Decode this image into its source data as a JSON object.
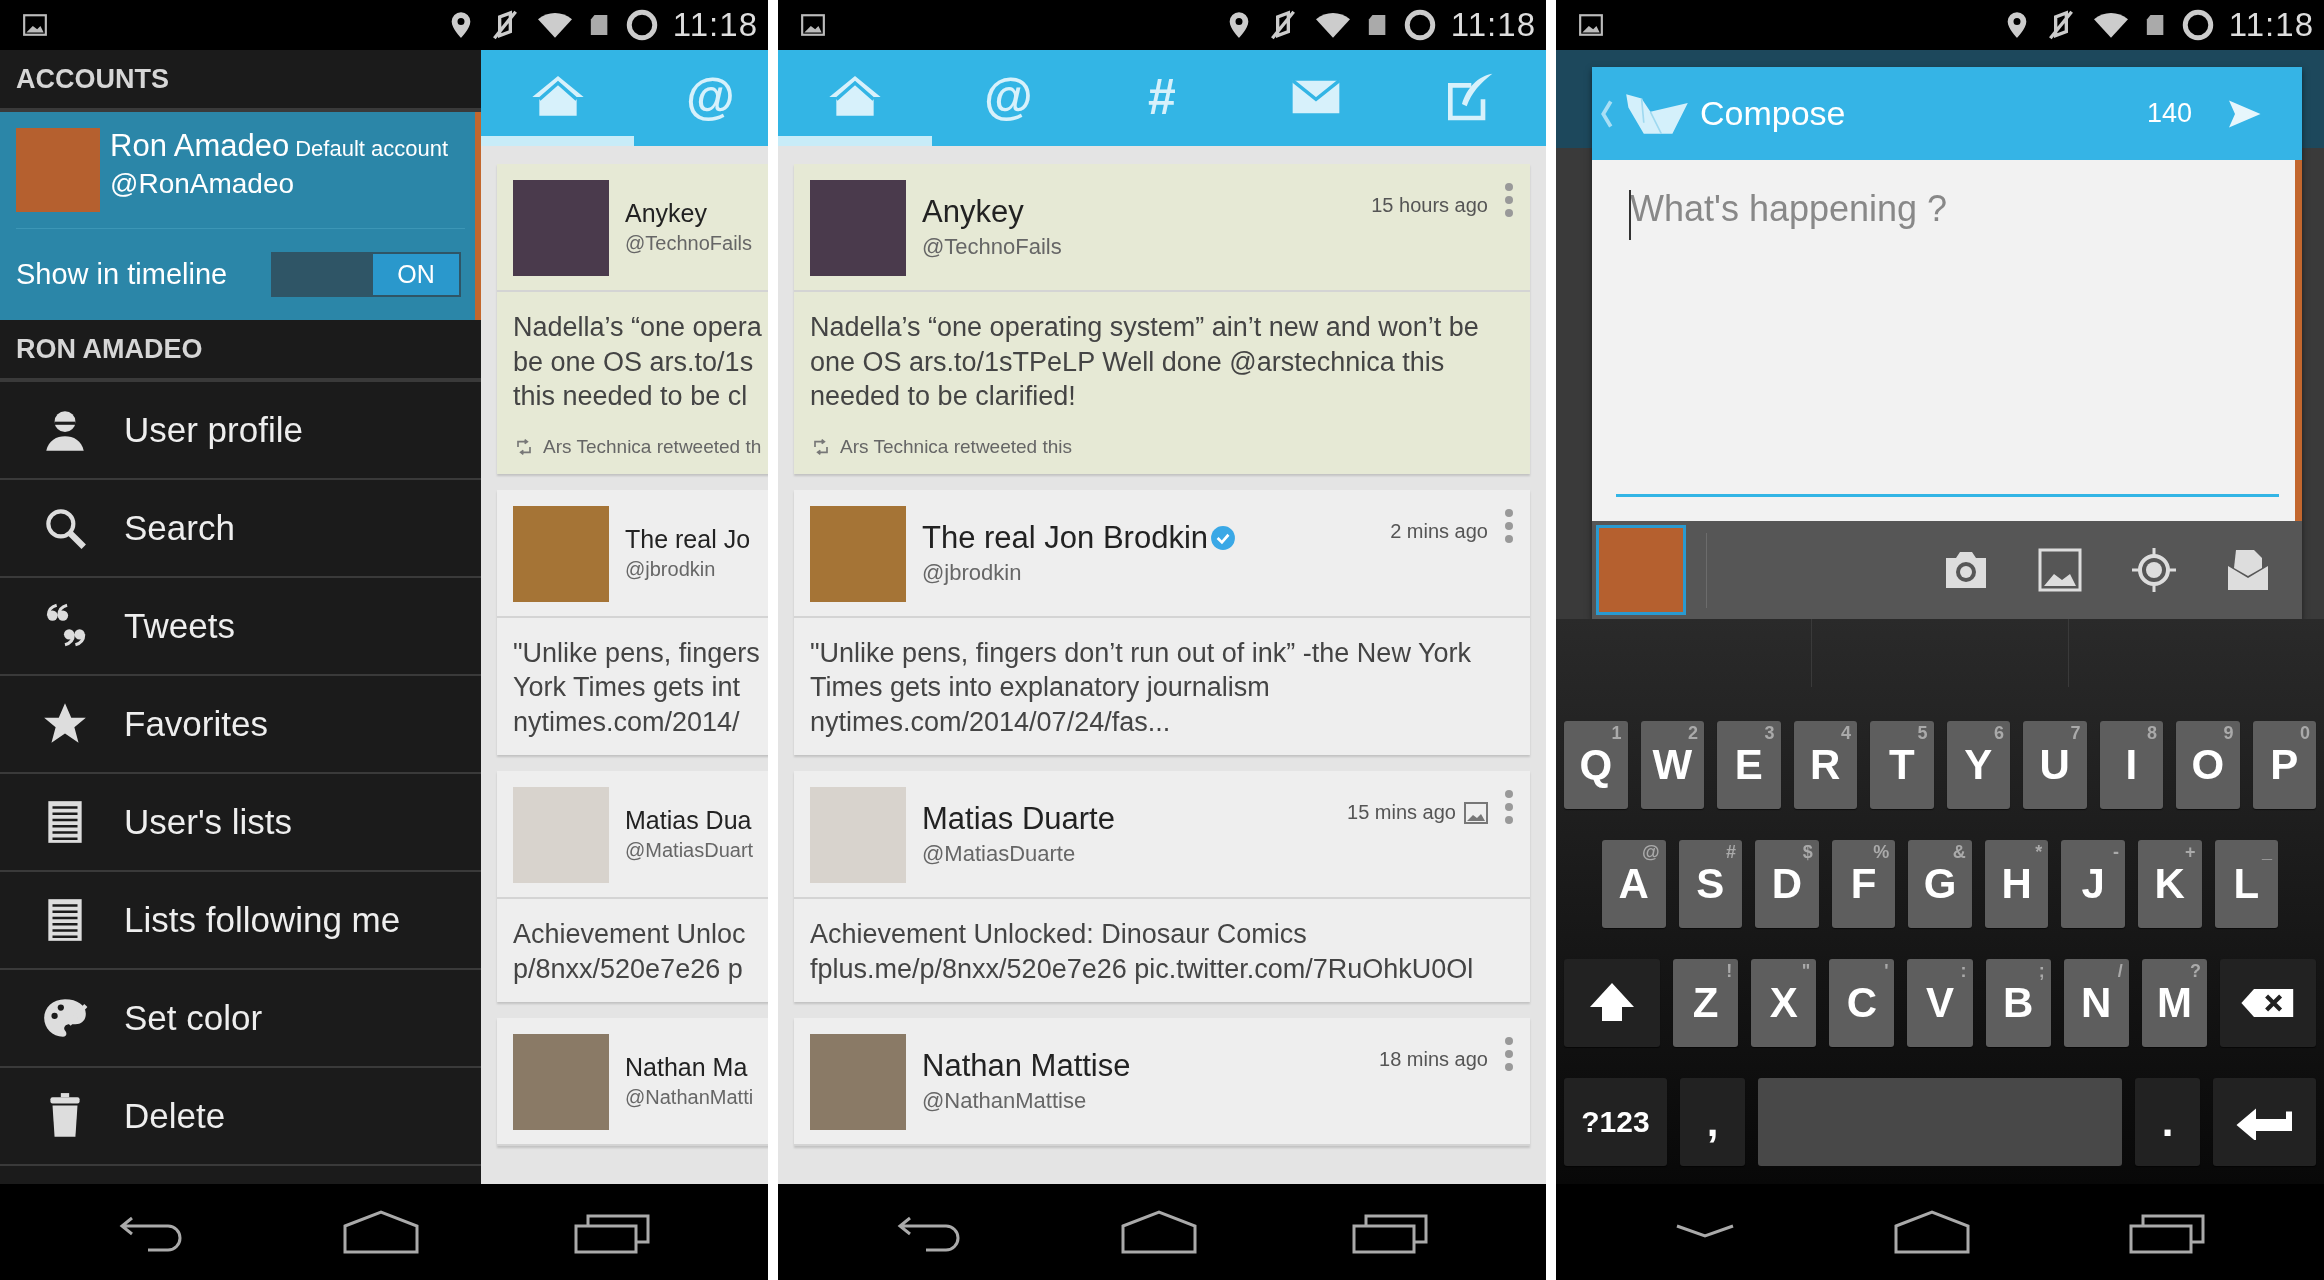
{
  "screens": [
    {
      "kind": "drawer",
      "status_bar": {
        "time": "11:18"
      },
      "nav_bar": {
        "dismiss_keyboard": false
      },
      "drawer": {
        "accounts_header": "ACCOUNTS",
        "account": {
          "name": "Ron Amadeo",
          "badge": "Default account",
          "handle": "@RonAmadeo",
          "toggle_label": "Show in timeline",
          "toggle_on": true,
          "toggle_text": "ON"
        },
        "section_header": "RON AMADEO",
        "items": [
          {
            "kind": "profile",
            "label": "User profile"
          },
          {
            "kind": "search",
            "label": "Search"
          },
          {
            "kind": "tweets",
            "label": "Tweets"
          },
          {
            "kind": "favorites",
            "label": "Favorites"
          },
          {
            "kind": "list",
            "label": "User's lists"
          },
          {
            "kind": "list",
            "label": "Lists following me"
          },
          {
            "kind": "color",
            "label": "Set color"
          },
          {
            "kind": "delete",
            "label": "Delete"
          }
        ]
      },
      "feed": {
        "tabs": [
          {
            "kind": "home",
            "selected": true
          },
          {
            "kind": "text",
            "label": "@",
            "selected": false
          }
        ],
        "cards": [
          {
            "name": "Anykey",
            "handle": "@TechnoFails",
            "highlighted": true,
            "lines": [
              "Nadella’s “one opera",
              "be one OS ars.to/1s",
              "this needed to be cl"
            ],
            "retweet": "Ars Technica retweeted th"
          },
          {
            "name": "The real Jo",
            "handle": "@jbrodkin",
            "highlighted": false,
            "lines": [
              "\"Unlike pens, fingers",
              "York Times gets int",
              "nytimes.com/2014/"
            ]
          },
          {
            "name": "Matias Dua",
            "handle": "@MatiasDuart",
            "highlighted": false,
            "lines": [
              "Achievement Unloc",
              "p/8nxx/520e7e26 p"
            ]
          },
          {
            "name": "Nathan Ma",
            "handle": "@NathanMatti",
            "highlighted": false
          }
        ]
      }
    },
    {
      "kind": "timeline",
      "status_bar": {
        "time": "11:18"
      },
      "nav_bar": {
        "dismiss_keyboard": false
      },
      "feed": {
        "tabs": [
          {
            "kind": "home",
            "selected": true
          },
          {
            "kind": "text",
            "label": "@",
            "selected": false
          },
          {
            "kind": "text",
            "label": "#",
            "selected": false
          },
          {
            "kind": "messages",
            "selected": false
          },
          {
            "kind": "compose",
            "selected": false
          }
        ],
        "cards": [
          {
            "name": "Anykey",
            "handle": "@TechnoFails",
            "time": "15 hours ago",
            "highlighted": true,
            "body": "Nadella’s “one operating system” ain’t new and won’t be one OS ars.to/1sTPeLP Well done @arstechnica this needed to be clarified!",
            "retweet": "Ars Technica retweeted this"
          },
          {
            "name": "The real Jon Brodkin",
            "verified": true,
            "handle": "@jbrodkin",
            "time": "2 mins ago",
            "highlighted": false,
            "body": "\"Unlike pens, fingers don’t run out of ink” -the New York Times gets into explanatory journalism nytimes.com/2014/07/24/fas..."
          },
          {
            "name": "Matias Duarte",
            "handle": "@MatiasDuarte",
            "time": "15 mins ago",
            "media": true,
            "highlighted": false,
            "body": "Achievement Unlocked: Dinosaur Comics fplus.me/p/8nxx/520e7e26 pic.twitter.com/7RuOhkU0Ol"
          },
          {
            "name": "Nathan Mattise",
            "handle": "@NathanMattise",
            "time": "18 mins ago",
            "highlighted": false
          }
        ]
      }
    },
    {
      "kind": "compose",
      "status_bar": {
        "time": "11:18"
      },
      "nav_bar": {
        "dismiss_keyboard": true
      },
      "compose": {
        "title": "Compose",
        "counter": "140",
        "placeholder": "What's happening ?"
      },
      "keyboard": {
        "rows": [
          {
            "keys": [
              {
                "kind": "letter",
                "label": "Q",
                "hint": "1"
              },
              {
                "kind": "letter",
                "label": "W",
                "hint": "2"
              },
              {
                "kind": "letter",
                "label": "E",
                "hint": "3"
              },
              {
                "kind": "letter",
                "label": "R",
                "hint": "4"
              },
              {
                "kind": "letter",
                "label": "T",
                "hint": "5"
              },
              {
                "kind": "letter",
                "label": "Y",
                "hint": "6"
              },
              {
                "kind": "letter",
                "label": "U",
                "hint": "7"
              },
              {
                "kind": "letter",
                "label": "I",
                "hint": "8"
              },
              {
                "kind": "letter",
                "label": "O",
                "hint": "9"
              },
              {
                "kind": "letter",
                "label": "P",
                "hint": "0"
              }
            ]
          },
          {
            "keys": [
              {
                "kind": "letter",
                "label": "A",
                "hint": "@"
              },
              {
                "kind": "letter",
                "label": "S",
                "hint": "#"
              },
              {
                "kind": "letter",
                "label": "D",
                "hint": "$"
              },
              {
                "kind": "letter",
                "label": "F",
                "hint": "%"
              },
              {
                "kind": "letter",
                "label": "G",
                "hint": "&"
              },
              {
                "kind": "letter",
                "label": "H",
                "hint": "*"
              },
              {
                "kind": "letter",
                "label": "J",
                "hint": "-"
              },
              {
                "kind": "letter",
                "label": "K",
                "hint": "+"
              },
              {
                "kind": "letter",
                "label": "L",
                "hint": "_"
              }
            ]
          },
          {
            "keys": [
              {
                "kind": "shift"
              },
              {
                "kind": "letter",
                "label": "Z",
                "hint": "!"
              },
              {
                "kind": "letter",
                "label": "X",
                "hint": "\""
              },
              {
                "kind": "letter",
                "label": "C",
                "hint": "'"
              },
              {
                "kind": "letter",
                "label": "V",
                "hint": ":"
              },
              {
                "kind": "letter",
                "label": "B",
                "hint": ";"
              },
              {
                "kind": "letter",
                "label": "N",
                "hint": "/"
              },
              {
                "kind": "letter",
                "label": "M",
                "hint": "?"
              },
              {
                "kind": "backspace"
              }
            ]
          },
          {
            "keys": [
              {
                "kind": "symbols",
                "label": "?123"
              },
              {
                "kind": "punct",
                "label": ","
              },
              {
                "kind": "space"
              },
              {
                "kind": "punct",
                "label": "."
              },
              {
                "kind": "enter"
              }
            ]
          }
        ]
      }
    }
  ]
}
